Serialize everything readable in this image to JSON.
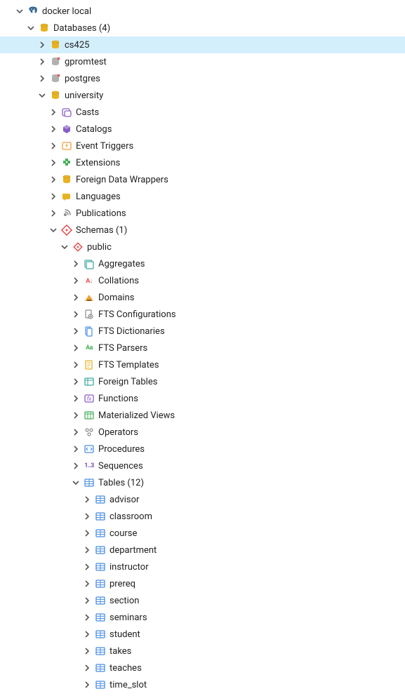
{
  "tree": [
    {
      "id": "server",
      "depth": 0,
      "expand": "open",
      "icon": "elephant",
      "label": "docker local"
    },
    {
      "id": "databases",
      "depth": 1,
      "expand": "open",
      "icon": "db-group",
      "label": "Databases (4)"
    },
    {
      "id": "db-cs425",
      "depth": 2,
      "expand": "closed",
      "icon": "db",
      "label": "cs425",
      "selected": true
    },
    {
      "id": "db-gpromtest",
      "depth": 2,
      "expand": "closed",
      "icon": "db-off",
      "label": "gpromtest"
    },
    {
      "id": "db-postgres",
      "depth": 2,
      "expand": "closed",
      "icon": "db-off",
      "label": "postgres"
    },
    {
      "id": "db-university",
      "depth": 2,
      "expand": "open",
      "icon": "db",
      "label": "university"
    },
    {
      "id": "casts",
      "depth": 3,
      "expand": "closed",
      "icon": "casts",
      "label": "Casts"
    },
    {
      "id": "catalogs",
      "depth": 3,
      "expand": "closed",
      "icon": "catalogs",
      "label": "Catalogs"
    },
    {
      "id": "evt-triggers",
      "depth": 3,
      "expand": "closed",
      "icon": "evt-trigger",
      "label": "Event Triggers"
    },
    {
      "id": "extensions",
      "depth": 3,
      "expand": "closed",
      "icon": "extension",
      "label": "Extensions"
    },
    {
      "id": "fdw",
      "depth": 3,
      "expand": "closed",
      "icon": "db-group",
      "label": "Foreign Data Wrappers"
    },
    {
      "id": "languages",
      "depth": 3,
      "expand": "closed",
      "icon": "language",
      "label": "Languages"
    },
    {
      "id": "publications",
      "depth": 3,
      "expand": "closed",
      "icon": "publication",
      "label": "Publications"
    },
    {
      "id": "schemas",
      "depth": 3,
      "expand": "open",
      "icon": "schema",
      "label": "Schemas (1)"
    },
    {
      "id": "public",
      "depth": 4,
      "expand": "open",
      "icon": "schema-leaf",
      "label": "public"
    },
    {
      "id": "aggregates",
      "depth": 5,
      "expand": "closed",
      "icon": "aggregate",
      "label": "Aggregates"
    },
    {
      "id": "collations",
      "depth": 5,
      "expand": "closed",
      "icon": "collation",
      "label": "Collations"
    },
    {
      "id": "domains",
      "depth": 5,
      "expand": "closed",
      "icon": "domain",
      "label": "Domains"
    },
    {
      "id": "fts-conf",
      "depth": 5,
      "expand": "closed",
      "icon": "fts-conf",
      "label": "FTS Configurations"
    },
    {
      "id": "fts-dict",
      "depth": 5,
      "expand": "closed",
      "icon": "fts-dict",
      "label": "FTS Dictionaries"
    },
    {
      "id": "fts-parsers",
      "depth": 5,
      "expand": "closed",
      "icon": "fts-parser",
      "label": "FTS Parsers"
    },
    {
      "id": "fts-templates",
      "depth": 5,
      "expand": "closed",
      "icon": "fts-template",
      "label": "FTS Templates"
    },
    {
      "id": "foreign-tables",
      "depth": 5,
      "expand": "closed",
      "icon": "foreign-table",
      "label": "Foreign Tables"
    },
    {
      "id": "functions",
      "depth": 5,
      "expand": "closed",
      "icon": "function",
      "label": "Functions"
    },
    {
      "id": "mat-views",
      "depth": 5,
      "expand": "closed",
      "icon": "mat-view",
      "label": "Materialized Views"
    },
    {
      "id": "operators",
      "depth": 5,
      "expand": "closed",
      "icon": "operator",
      "label": "Operators"
    },
    {
      "id": "procedures",
      "depth": 5,
      "expand": "closed",
      "icon": "procedure",
      "label": "Procedures"
    },
    {
      "id": "sequences",
      "depth": 5,
      "expand": "closed",
      "icon": "sequence",
      "label": "Sequences"
    },
    {
      "id": "tables",
      "depth": 5,
      "expand": "open",
      "icon": "table",
      "label": "Tables (12)"
    },
    {
      "id": "t-advisor",
      "depth": 6,
      "expand": "closed",
      "icon": "table-leaf",
      "label": "advisor"
    },
    {
      "id": "t-classroom",
      "depth": 6,
      "expand": "closed",
      "icon": "table-leaf",
      "label": "classroom"
    },
    {
      "id": "t-course",
      "depth": 6,
      "expand": "closed",
      "icon": "table-leaf",
      "label": "course"
    },
    {
      "id": "t-department",
      "depth": 6,
      "expand": "closed",
      "icon": "table-leaf",
      "label": "department"
    },
    {
      "id": "t-instructor",
      "depth": 6,
      "expand": "closed",
      "icon": "table-leaf",
      "label": "instructor"
    },
    {
      "id": "t-prereq",
      "depth": 6,
      "expand": "closed",
      "icon": "table-leaf",
      "label": "prereq"
    },
    {
      "id": "t-section",
      "depth": 6,
      "expand": "closed",
      "icon": "table-leaf",
      "label": "section"
    },
    {
      "id": "t-seminars",
      "depth": 6,
      "expand": "closed",
      "icon": "table-leaf",
      "label": "seminars"
    },
    {
      "id": "t-student",
      "depth": 6,
      "expand": "closed",
      "icon": "table-leaf",
      "label": "student"
    },
    {
      "id": "t-takes",
      "depth": 6,
      "expand": "closed",
      "icon": "table-leaf",
      "label": "takes"
    },
    {
      "id": "t-teaches",
      "depth": 6,
      "expand": "closed",
      "icon": "table-leaf",
      "label": "teaches"
    },
    {
      "id": "t-time_slot",
      "depth": 6,
      "expand": "closed",
      "icon": "table-leaf",
      "label": "time_slot"
    }
  ],
  "layout": {
    "baseIndent": 20,
    "levelIndent": 16
  },
  "colors": {
    "selectedBg": "#d4effc",
    "dbGold": "#e8b323",
    "dbGrey": "#b0b0b0",
    "elephant": "#336791",
    "purple": "#8a5cc6",
    "orange": "#f0a13a",
    "green": "#49b05c",
    "red": "#e44d4d",
    "blue": "#4a8fe2",
    "teal": "#3ea9a1",
    "darkPurple": "#7b4db3",
    "grey": "#8a8a8a"
  }
}
